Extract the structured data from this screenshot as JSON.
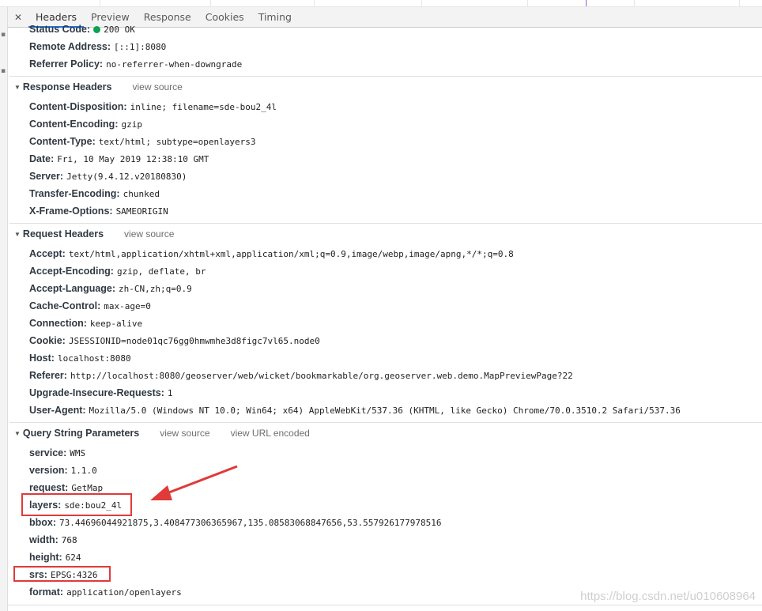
{
  "tabs": {
    "close_symbol": "✕",
    "items": [
      "Headers",
      "Preview",
      "Response",
      "Cookies",
      "Timing"
    ],
    "active": "Headers"
  },
  "general": {
    "status_code": {
      "name": "Status Code:",
      "value": "200 OK"
    },
    "remote_address": {
      "name": "Remote Address:",
      "value": "[::1]:8080"
    },
    "referrer_policy": {
      "name": "Referrer Policy:",
      "value": "no-referrer-when-downgrade"
    },
    "status_color": "#0aa34f"
  },
  "response_headers": {
    "title": "Response Headers",
    "link": "view source",
    "items": [
      {
        "name": "Content-Disposition:",
        "value": "inline; filename=sde-bou2_4l"
      },
      {
        "name": "Content-Encoding:",
        "value": "gzip"
      },
      {
        "name": "Content-Type:",
        "value": "text/html; subtype=openlayers3"
      },
      {
        "name": "Date:",
        "value": "Fri, 10 May 2019 12:38:10 GMT"
      },
      {
        "name": "Server:",
        "value": "Jetty(9.4.12.v20180830)"
      },
      {
        "name": "Transfer-Encoding:",
        "value": "chunked"
      },
      {
        "name": "X-Frame-Options:",
        "value": "SAMEORIGIN"
      }
    ]
  },
  "request_headers": {
    "title": "Request Headers",
    "link": "view source",
    "items": [
      {
        "name": "Accept:",
        "value": "text/html,application/xhtml+xml,application/xml;q=0.9,image/webp,image/apng,*/*;q=0.8"
      },
      {
        "name": "Accept-Encoding:",
        "value": "gzip, deflate, br"
      },
      {
        "name": "Accept-Language:",
        "value": "zh-CN,zh;q=0.9"
      },
      {
        "name": "Cache-Control:",
        "value": "max-age=0"
      },
      {
        "name": "Connection:",
        "value": "keep-alive"
      },
      {
        "name": "Cookie:",
        "value": "JSESSIONID=node01qc76gg0hmwmhe3d8figc7vl65.node0"
      },
      {
        "name": "Host:",
        "value": "localhost:8080"
      },
      {
        "name": "Referer:",
        "value": "http://localhost:8080/geoserver/web/wicket/bookmarkable/org.geoserver.web.demo.MapPreviewPage?22"
      },
      {
        "name": "Upgrade-Insecure-Requests:",
        "value": "1"
      },
      {
        "name": "User-Agent:",
        "value": "Mozilla/5.0 (Windows NT 10.0; Win64; x64) AppleWebKit/537.36 (KHTML, like Gecko) Chrome/70.0.3510.2 Safari/537.36"
      }
    ]
  },
  "query_params": {
    "title": "Query String Parameters",
    "link_source": "view source",
    "link_encoded": "view URL encoded",
    "items": [
      {
        "name": "service:",
        "value": "WMS"
      },
      {
        "name": "version:",
        "value": "1.1.0"
      },
      {
        "name": "request:",
        "value": "GetMap"
      },
      {
        "name": "layers:",
        "value": "sde:bou2_4l"
      },
      {
        "name": "bbox:",
        "value": "73.44696044921875,3.408477306365967,135.08583068847656,53.557926177978516"
      },
      {
        "name": "width:",
        "value": "768"
      },
      {
        "name": "height:",
        "value": "624"
      },
      {
        "name": "srs:",
        "value": "EPSG:4326"
      },
      {
        "name": "format:",
        "value": "application/openlayers"
      }
    ]
  },
  "annotation_color": "#e03a3a",
  "watermark": "https://blog.csdn.net/u010608964"
}
